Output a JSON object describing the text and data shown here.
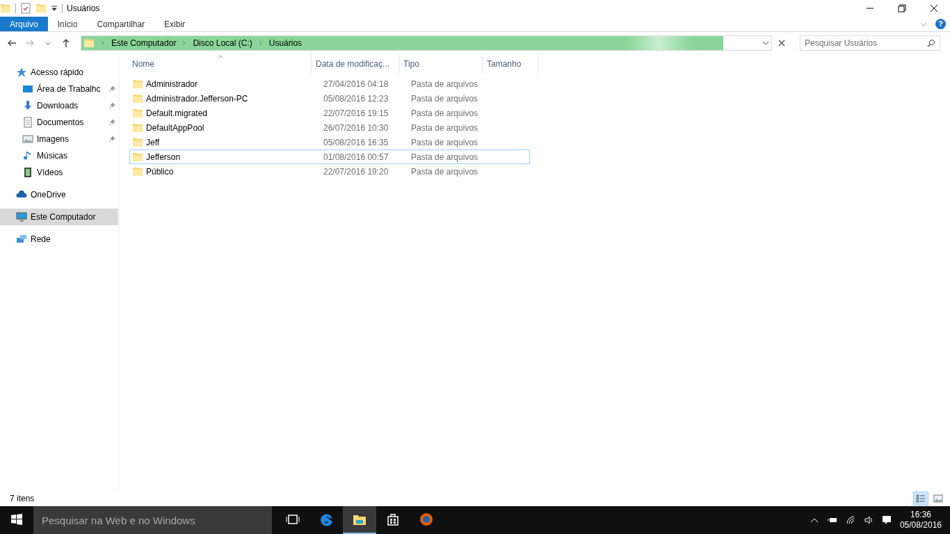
{
  "window": {
    "title": "Usuários",
    "help_button": "?"
  },
  "ribbon_tabs": [
    {
      "label": "Arquivo",
      "selected": true
    },
    {
      "label": "Início",
      "selected": false
    },
    {
      "label": "Compartilhar",
      "selected": false
    },
    {
      "label": "Exibir",
      "selected": false
    }
  ],
  "address_bar": {
    "crumbs": [
      "Este Computador",
      "Disco Local (C:)",
      "Usuários"
    ],
    "level": 0.93
  },
  "search": {
    "placeholder": "Pesquisar Usuários"
  },
  "sidebar": {
    "items": [
      {
        "label": "Acesso rápido",
        "kind": "star",
        "selected": false,
        "children": [
          {
            "label": "Área de Trabalhc",
            "kind": "desktop",
            "pinned": true,
            "selected": false
          },
          {
            "label": "Downloads",
            "kind": "download",
            "pinned": true,
            "selected": false
          },
          {
            "label": "Documentos",
            "kind": "document",
            "pinned": true,
            "selected": false
          },
          {
            "label": "Imagens",
            "kind": "image",
            "pinned": true,
            "selected": false
          },
          {
            "label": "Músicas",
            "kind": "music",
            "pinned": false,
            "selected": false
          },
          {
            "label": "Vídeos",
            "kind": "video",
            "pinned": false,
            "selected": false
          }
        ]
      },
      {
        "label": "OneDrive",
        "kind": "cloud",
        "selected": false
      },
      {
        "label": "Este Computador",
        "kind": "computer",
        "selected": true
      },
      {
        "label": "Rede",
        "kind": "network",
        "selected": false
      }
    ]
  },
  "table": {
    "columns": [
      {
        "label": "Nome",
        "sorted": true
      },
      {
        "label": "Data de modificaç...",
        "sorted": false
      },
      {
        "label": "Tipo",
        "sorted": false
      },
      {
        "label": "Tamanho",
        "sorted": false
      }
    ],
    "rows": [
      {
        "name": "Administrador",
        "date": "27/04/2016 04:18",
        "type": "Pasta de arquivos",
        "focused": false
      },
      {
        "name": "Administrador.Jefferson-PC",
        "date": "05/08/2016 12:23",
        "type": "Pasta de arquivos",
        "focused": false
      },
      {
        "name": "Default.migrated",
        "date": "22/07/2016 19:15",
        "type": "Pasta de arquivos",
        "focused": false
      },
      {
        "name": "DefaultAppPool",
        "date": "26/07/2016 10:30",
        "type": "Pasta de arquivos",
        "focused": false
      },
      {
        "name": "Jeff",
        "date": "05/08/2016 16:35",
        "type": "Pasta de arquivos",
        "focused": false
      },
      {
        "name": "Jefferson",
        "date": "01/08/2016 00:57",
        "type": "Pasta de arquivos",
        "focused": true
      },
      {
        "name": "Público",
        "date": "22/07/2016 19:20",
        "type": "Pasta de arquivos",
        "focused": false
      }
    ]
  },
  "status_bar": {
    "text": "7 itens",
    "view_modes": [
      {
        "kind": "details",
        "selected": true
      },
      {
        "kind": "tiles",
        "selected": false
      }
    ]
  },
  "taskbar": {
    "search_placeholder": "Pesquisar na Web e no Windows",
    "apps": [
      {
        "kind": "taskview",
        "active": false
      },
      {
        "kind": "edge",
        "active": false
      },
      {
        "kind": "explorer",
        "active": true
      },
      {
        "kind": "store",
        "active": false
      },
      {
        "kind": "firefox",
        "active": false
      }
    ],
    "time": "16:36",
    "date": "05/08/2016"
  }
}
